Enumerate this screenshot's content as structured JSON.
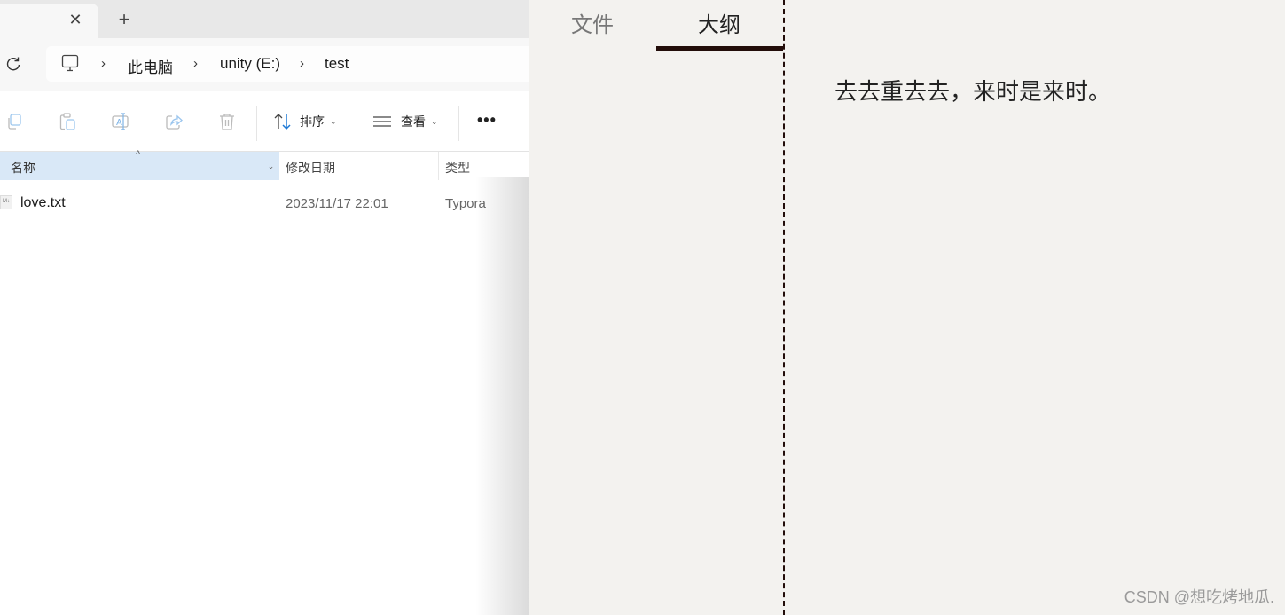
{
  "explorer": {
    "tab": {
      "close_icon": "close-icon",
      "new_tab_icon": "plus-icon"
    },
    "address": {
      "refresh_icon": "refresh-icon",
      "computer_icon": "computer-icon",
      "separator": "›",
      "crumbs": [
        "此电脑",
        "unity (E:)",
        "test"
      ]
    },
    "toolbar": {
      "icons": [
        "copy-icon",
        "paste-icon",
        "rename-icon",
        "share-icon",
        "delete-icon"
      ],
      "sort_label": "排序",
      "view_label": "查看",
      "more_label": "•••"
    },
    "columns": {
      "name": "名称",
      "date": "修改日期",
      "type": "类型"
    },
    "files": [
      {
        "name": "love.txt",
        "modified": "2023/11/17 22:01",
        "type": "Typora",
        "icon_label": "M↓"
      }
    ]
  },
  "typora": {
    "sidebar_tabs": [
      "文件",
      "大纲"
    ],
    "active_tab": "大纲",
    "content": "去去重去去，来时是来时。"
  },
  "watermark": "CSDN @想吃烤地瓜."
}
